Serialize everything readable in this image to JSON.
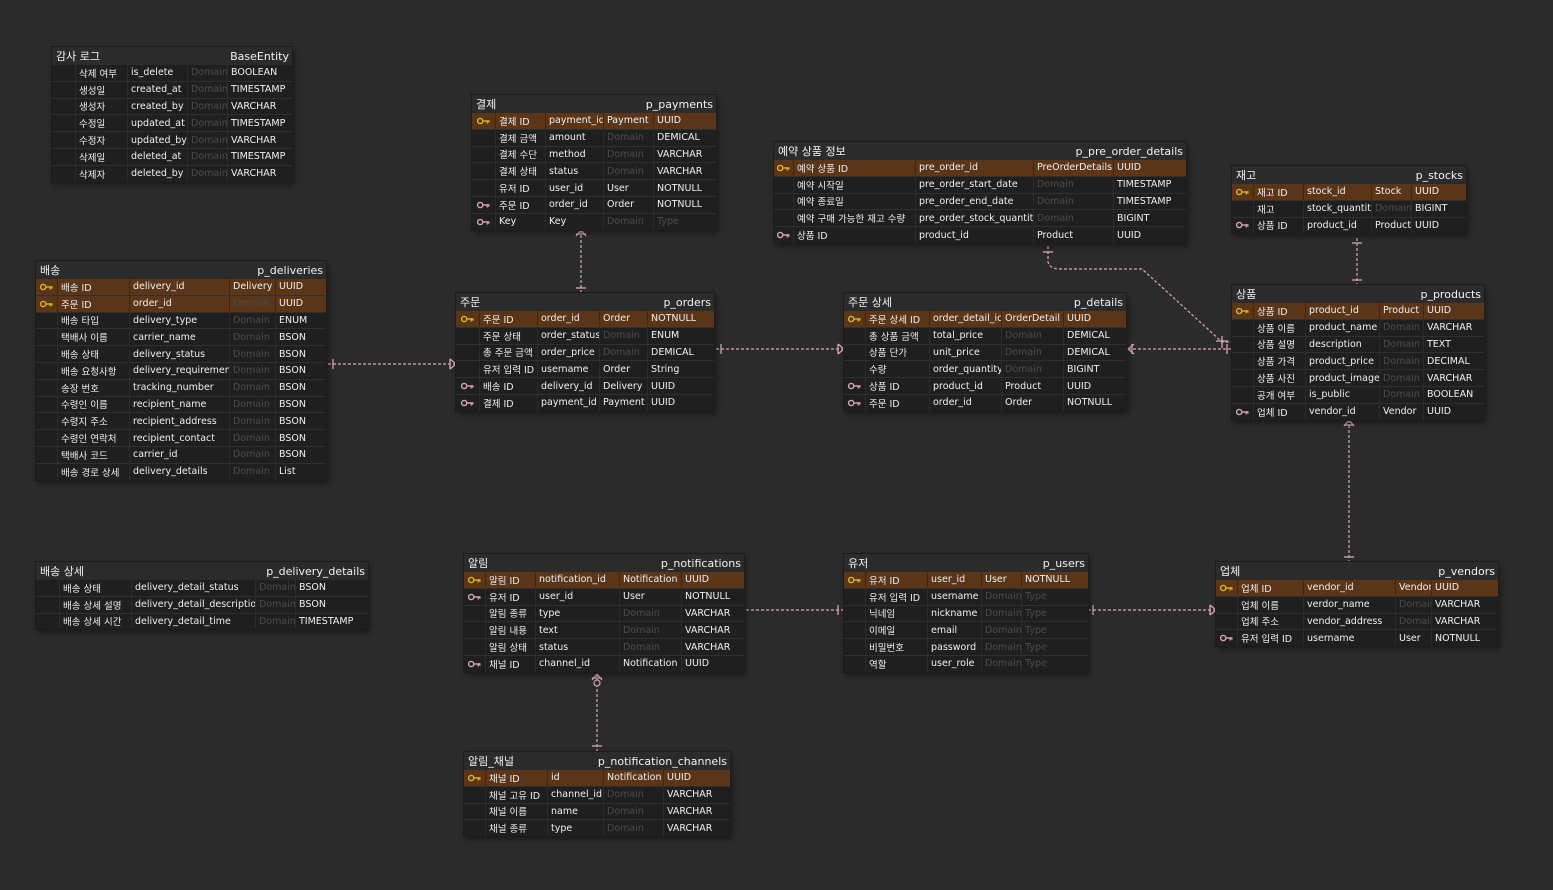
{
  "entities": [
    {
      "id": "base",
      "title": "감사 로그",
      "name": "BaseEntity",
      "rows": [
        {
          "key": "",
          "logical": "삭제 여부",
          "physical": "is_delete",
          "domain": "Domain",
          "domain_placeholder": true,
          "type": "BOOLEAN"
        },
        {
          "key": "",
          "logical": "생성일",
          "physical": "created_at",
          "domain": "Domain",
          "domain_placeholder": true,
          "type": "TIMESTAMP"
        },
        {
          "key": "",
          "logical": "생성자",
          "physical": "created_by",
          "domain": "Domain",
          "domain_placeholder": true,
          "type": "VARCHAR"
        },
        {
          "key": "",
          "logical": "수정일",
          "physical": "updated_at",
          "domain": "Domain",
          "domain_placeholder": true,
          "type": "TIMESTAMP"
        },
        {
          "key": "",
          "logical": "수정자",
          "physical": "updated_by",
          "domain": "Domain",
          "domain_placeholder": true,
          "type": "VARCHAR"
        },
        {
          "key": "",
          "logical": "삭제일",
          "physical": "deleted_at",
          "domain": "Domain",
          "domain_placeholder": true,
          "type": "TIMESTAMP"
        },
        {
          "key": "",
          "logical": "삭제자",
          "physical": "deleted_by",
          "domain": "Domain",
          "domain_placeholder": true,
          "type": "VARCHAR"
        }
      ]
    },
    {
      "id": "payments",
      "title": "결제",
      "name": "p_payments",
      "rows": [
        {
          "key": "pk",
          "logical": "결제 ID",
          "physical": "payment_id",
          "domain": "Payment",
          "domain_placeholder": false,
          "type": "UUID"
        },
        {
          "key": "",
          "logical": "결제 금액",
          "physical": "amount",
          "domain": "Domain",
          "domain_placeholder": true,
          "type": "DEMICAL"
        },
        {
          "key": "",
          "logical": "결제 수단",
          "physical": "method",
          "domain": "Domain",
          "domain_placeholder": true,
          "type": "VARCHAR"
        },
        {
          "key": "",
          "logical": "결제 상태",
          "physical": "status",
          "domain": "Domain",
          "domain_placeholder": true,
          "type": "VARCHAR"
        },
        {
          "key": "",
          "logical": "유저 ID",
          "physical": "user_id",
          "domain": "User",
          "domain_placeholder": false,
          "type": "NOTNULL"
        },
        {
          "key": "fk",
          "logical": "주문 ID",
          "physical": "order_id",
          "domain": "Order",
          "domain_placeholder": false,
          "type": "NOTNULL"
        },
        {
          "key": "fk",
          "logical": "Key",
          "physical": "Key",
          "domain": "Domain",
          "domain_placeholder": true,
          "type": "Type",
          "type_placeholder": true
        }
      ]
    },
    {
      "id": "preorder",
      "title": "예약 상품 정보",
      "name": "p_pre_order_details",
      "rows": [
        {
          "key": "pk",
          "logical": "예약 상품 ID",
          "physical": "pre_order_id",
          "domain": "PreOrderDetails",
          "domain_placeholder": false,
          "type": "UUID"
        },
        {
          "key": "",
          "logical": "예약 시작일",
          "physical": "pre_order_start_date",
          "domain": "Domain",
          "domain_placeholder": true,
          "type": "TIMESTAMP"
        },
        {
          "key": "",
          "logical": "예약 종료일",
          "physical": "pre_order_end_date",
          "domain": "Domain",
          "domain_placeholder": true,
          "type": "TIMESTAMP"
        },
        {
          "key": "",
          "logical": "예약 구매 가능한 재고 수량",
          "physical": "pre_order_stock_quantity",
          "domain": "Domain",
          "domain_placeholder": true,
          "type": "BIGINT"
        },
        {
          "key": "fk",
          "logical": "상품 ID",
          "physical": "product_id",
          "domain": "Product",
          "domain_placeholder": false,
          "type": "UUID"
        }
      ]
    },
    {
      "id": "stocks",
      "title": "재고",
      "name": "p_stocks",
      "rows": [
        {
          "key": "pk",
          "logical": "재고 ID",
          "physical": "stock_id",
          "domain": "Stock",
          "domain_placeholder": false,
          "type": "UUID"
        },
        {
          "key": "",
          "logical": "재고",
          "physical": "stock_quantity",
          "domain": "Domain",
          "domain_placeholder": true,
          "type": "BIGINT"
        },
        {
          "key": "fk",
          "logical": "상품 ID",
          "physical": "product_id",
          "domain": "Product",
          "domain_placeholder": false,
          "type": "UUID"
        }
      ]
    },
    {
      "id": "deliveries",
      "title": "배송",
      "name": "p_deliveries",
      "rows": [
        {
          "key": "pk",
          "logical": "배송 ID",
          "physical": "delivery_id",
          "domain": "Delivery",
          "domain_placeholder": false,
          "type": "UUID"
        },
        {
          "key": "pk",
          "logical": "주문 ID",
          "physical": "order_id",
          "domain": "Domain",
          "domain_placeholder": true,
          "type": "UUID"
        },
        {
          "key": "",
          "logical": "배송 타입",
          "physical": "delivery_type",
          "domain": "Domain",
          "domain_placeholder": true,
          "type": "ENUM"
        },
        {
          "key": "",
          "logical": "택배사 이름",
          "physical": "carrier_name",
          "domain": "Domain",
          "domain_placeholder": true,
          "type": "BSON"
        },
        {
          "key": "",
          "logical": "배송 상태",
          "physical": "delivery_status",
          "domain": "Domain",
          "domain_placeholder": true,
          "type": "BSON"
        },
        {
          "key": "",
          "logical": "배송 요청사항",
          "physical": "delivery_requirement",
          "domain": "Domain",
          "domain_placeholder": true,
          "type": "BSON"
        },
        {
          "key": "",
          "logical": "송장 번호",
          "physical": "tracking_number",
          "domain": "Domain",
          "domain_placeholder": true,
          "type": "BSON"
        },
        {
          "key": "",
          "logical": "수령인 이름",
          "physical": "recipient_name",
          "domain": "Domain",
          "domain_placeholder": true,
          "type": "BSON"
        },
        {
          "key": "",
          "logical": "수령지 주소",
          "physical": "recipient_address",
          "domain": "Domain",
          "domain_placeholder": true,
          "type": "BSON"
        },
        {
          "key": "",
          "logical": "수령인 연락처",
          "physical": "recipient_contact",
          "domain": "Domain",
          "domain_placeholder": true,
          "type": "BSON"
        },
        {
          "key": "",
          "logical": "택배사 코드",
          "physical": "carrier_id",
          "domain": "Domain",
          "domain_placeholder": true,
          "type": "BSON"
        },
        {
          "key": "",
          "logical": "배송 경로 상세",
          "physical": "delivery_details",
          "domain": "Domain",
          "domain_placeholder": true,
          "type": "List"
        }
      ]
    },
    {
      "id": "orders",
      "title": "주문",
      "name": "p_orders",
      "rows": [
        {
          "key": "pk",
          "logical": "주문 ID",
          "physical": "order_id",
          "domain": "Order",
          "domain_placeholder": false,
          "type": "NOTNULL"
        },
        {
          "key": "",
          "logical": "주문 상태",
          "physical": "order_status",
          "domain": "Domain",
          "domain_placeholder": true,
          "type": "ENUM"
        },
        {
          "key": "",
          "logical": "총 주문 금액",
          "physical": "order_price",
          "domain": "Domain",
          "domain_placeholder": true,
          "type": "DEMICAL"
        },
        {
          "key": "",
          "logical": "유저 입력 ID",
          "physical": "username",
          "domain": "Order",
          "domain_placeholder": false,
          "type": "String"
        },
        {
          "key": "fk",
          "logical": "배송 ID",
          "physical": "delivery_id",
          "domain": "Delivery",
          "domain_placeholder": false,
          "type": "UUID"
        },
        {
          "key": "fk",
          "logical": "결제 ID",
          "physical": "payment_id",
          "domain": "Payment",
          "domain_placeholder": false,
          "type": "UUID"
        }
      ]
    },
    {
      "id": "details",
      "title": "주문 상세",
      "name": "p_details",
      "rows": [
        {
          "key": "pk",
          "logical": "주문 상세 ID",
          "physical": "order_detail_id",
          "domain": "OrderDetail",
          "domain_placeholder": false,
          "type": "UUID"
        },
        {
          "key": "",
          "logical": "총 상품 금액",
          "physical": "total_price",
          "domain": "Domain",
          "domain_placeholder": true,
          "type": "DEMICAL"
        },
        {
          "key": "",
          "logical": "상품 단가",
          "physical": "unit_price",
          "domain": "Domain",
          "domain_placeholder": true,
          "type": "DEMICAL"
        },
        {
          "key": "",
          "logical": "수량",
          "physical": "order_quantity",
          "domain": "Domain",
          "domain_placeholder": true,
          "type": "BIGINT"
        },
        {
          "key": "fk",
          "logical": "상품 ID",
          "physical": "product_id",
          "domain": "Product",
          "domain_placeholder": false,
          "type": "UUID"
        },
        {
          "key": "fk",
          "logical": "주문 ID",
          "physical": "order_id",
          "domain": "Order",
          "domain_placeholder": false,
          "type": "NOTNULL"
        }
      ]
    },
    {
      "id": "products",
      "title": "상품",
      "name": "p_products",
      "rows": [
        {
          "key": "pk",
          "logical": "상품 ID",
          "physical": "product_id",
          "domain": "Product",
          "domain_placeholder": false,
          "type": "UUID"
        },
        {
          "key": "",
          "logical": "상품 이름",
          "physical": "product_name",
          "domain": "Domain",
          "domain_placeholder": true,
          "type": "VARCHAR"
        },
        {
          "key": "",
          "logical": "상품 설명",
          "physical": "description",
          "domain": "Domain",
          "domain_placeholder": true,
          "type": "TEXT"
        },
        {
          "key": "",
          "logical": "상품 가격",
          "physical": "product_price",
          "domain": "Domain",
          "domain_placeholder": true,
          "type": "DECIMAL"
        },
        {
          "key": "",
          "logical": "상품 사진",
          "physical": "product_image",
          "domain": "Domain",
          "domain_placeholder": true,
          "type": "VARCHAR"
        },
        {
          "key": "",
          "logical": "공개 여부",
          "physical": "is_public",
          "domain": "Domain",
          "domain_placeholder": true,
          "type": "BOOLEAN"
        },
        {
          "key": "fk",
          "logical": "업체 ID",
          "physical": "vendor_id",
          "domain": "Vendor",
          "domain_placeholder": false,
          "type": "UUID"
        }
      ]
    },
    {
      "id": "delivery_details",
      "title": "배송 상세",
      "name": "p_delivery_details",
      "rows": [
        {
          "key": "",
          "logical": "배송 상태",
          "physical": "delivery_detail_status",
          "domain": "Domain",
          "domain_placeholder": true,
          "type": "BSON"
        },
        {
          "key": "",
          "logical": "배송 상세 설명",
          "physical": "delivery_detail_description",
          "domain": "Domain",
          "domain_placeholder": true,
          "type": "BSON"
        },
        {
          "key": "",
          "logical": "배송 상세 시간",
          "physical": "delivery_detail_time",
          "domain": "Domain",
          "domain_placeholder": true,
          "type": "TIMESTAMP"
        }
      ]
    },
    {
      "id": "notifications",
      "title": "알림",
      "name": "p_notifications",
      "rows": [
        {
          "key": "pk",
          "logical": "알림 ID",
          "physical": "notification_id",
          "domain": "Notification",
          "domain_placeholder": false,
          "type": "UUID"
        },
        {
          "key": "fk",
          "logical": "유저 ID",
          "physical": "user_id",
          "domain": "User",
          "domain_placeholder": false,
          "type": "NOTNULL"
        },
        {
          "key": "",
          "logical": "알림 종류",
          "physical": "type",
          "domain": "Domain",
          "domain_placeholder": true,
          "type": "VARCHAR"
        },
        {
          "key": "",
          "logical": "알림 내용",
          "physical": "text",
          "domain": "Domain",
          "domain_placeholder": true,
          "type": "VARCHAR"
        },
        {
          "key": "",
          "logical": "알림 상태",
          "physical": "status",
          "domain": "Domain",
          "domain_placeholder": true,
          "type": "VARCHAR"
        },
        {
          "key": "fk",
          "logical": "채널 ID",
          "physical": "channel_id",
          "domain": "Notification",
          "domain_placeholder": false,
          "type": "UUID"
        }
      ]
    },
    {
      "id": "users",
      "title": "유저",
      "name": "p_users",
      "rows": [
        {
          "key": "pk",
          "logical": "유저 ID",
          "physical": "user_id",
          "domain": "User",
          "domain_placeholder": false,
          "type": "NOTNULL"
        },
        {
          "key": "",
          "logical": "유저 입력 ID",
          "physical": "username",
          "domain": "Domain",
          "domain_placeholder": true,
          "type": "Type",
          "type_placeholder": true
        },
        {
          "key": "",
          "logical": "닉네임",
          "physical": "nickname",
          "domain": "Domain",
          "domain_placeholder": true,
          "type": "Type",
          "type_placeholder": true
        },
        {
          "key": "",
          "logical": "이메일",
          "physical": "email",
          "domain": "Domain",
          "domain_placeholder": true,
          "type": "Type",
          "type_placeholder": true
        },
        {
          "key": "",
          "logical": "비밀번호",
          "physical": "password",
          "domain": "Domain",
          "domain_placeholder": true,
          "type": "Type",
          "type_placeholder": true
        },
        {
          "key": "",
          "logical": "역할",
          "physical": "user_role",
          "domain": "Domain",
          "domain_placeholder": true,
          "type": "Type",
          "type_placeholder": true
        }
      ]
    },
    {
      "id": "vendors",
      "title": "업체",
      "name": "p_vendors",
      "rows": [
        {
          "key": "pk",
          "logical": "업체 ID",
          "physical": "vendor_id",
          "domain": "Vendor",
          "domain_placeholder": false,
          "type": "UUID"
        },
        {
          "key": "",
          "logical": "업체 이름",
          "physical": "verdor_name",
          "domain": "Domain",
          "domain_placeholder": true,
          "type": "VARCHAR"
        },
        {
          "key": "",
          "logical": "업체 주소",
          "physical": "vendor_address",
          "domain": "Domain",
          "domain_placeholder": true,
          "type": "VARCHAR"
        },
        {
          "key": "fk",
          "logical": "유저 입력 ID",
          "physical": "username",
          "domain": "User",
          "domain_placeholder": false,
          "type": "NOTNULL"
        }
      ]
    },
    {
      "id": "channels",
      "title": "알림_채널",
      "name": "p_notification_channels",
      "rows": [
        {
          "key": "pk",
          "logical": "채널 ID",
          "physical": "id",
          "domain": "Notification",
          "domain_placeholder": false,
          "type": "UUID"
        },
        {
          "key": "",
          "logical": "채널 고유 ID",
          "physical": "channel_id",
          "domain": "Domain",
          "domain_placeholder": true,
          "type": "VARCHAR"
        },
        {
          "key": "",
          "logical": "채널 이름",
          "physical": "name",
          "domain": "Domain",
          "domain_placeholder": true,
          "type": "VARCHAR"
        },
        {
          "key": "",
          "logical": "채널 종류",
          "physical": "type",
          "domain": "Domain",
          "domain_placeholder": true,
          "type": "VARCHAR"
        }
      ]
    }
  ],
  "colors": {
    "background": "#2b2b2b",
    "pk_row": "#5b3518",
    "row": "#1f1f1f",
    "pk_key": "#e0b22a",
    "fk_key": "#d7a3b6",
    "relation_line": "#d8a6b8"
  }
}
